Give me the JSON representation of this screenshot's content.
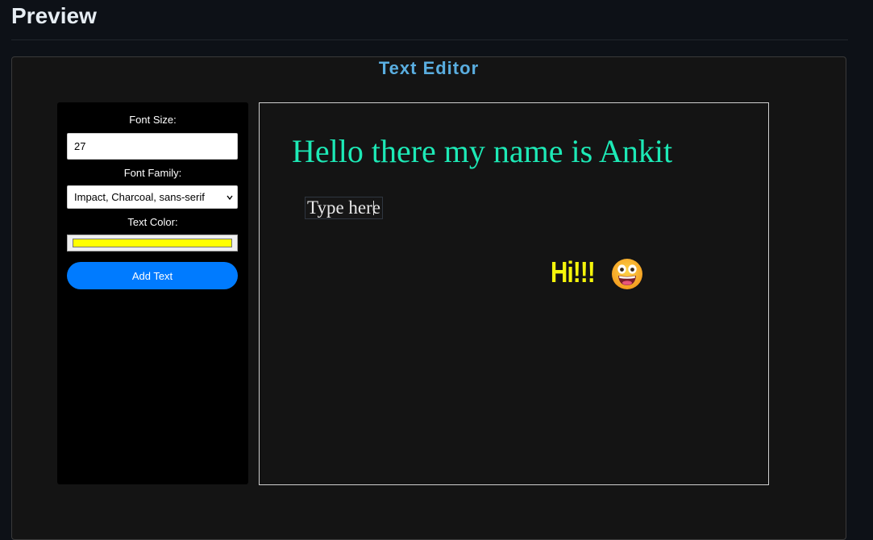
{
  "header": {
    "title": "Preview"
  },
  "editor": {
    "title": "Text Editor",
    "title_color": "#5aaee0"
  },
  "controls": {
    "font_size_label": "Font Size:",
    "font_size_value": "27",
    "font_family_label": "Font Family:",
    "font_family_value": "Impact, Charcoal, sans-serif",
    "text_color_label": "Text Color:",
    "text_color_value": "#ffff00",
    "add_text_button": "Add Text",
    "button_color": "#007bff"
  },
  "canvas": {
    "heading_text": "Hello there my name is Ankit",
    "heading_color": "#1de9b6",
    "editable_text": "Type here",
    "hi_text": "Hi!!!",
    "hi_color": "#f5f50b",
    "emoji": "grinning-face-with-big-eyes"
  }
}
